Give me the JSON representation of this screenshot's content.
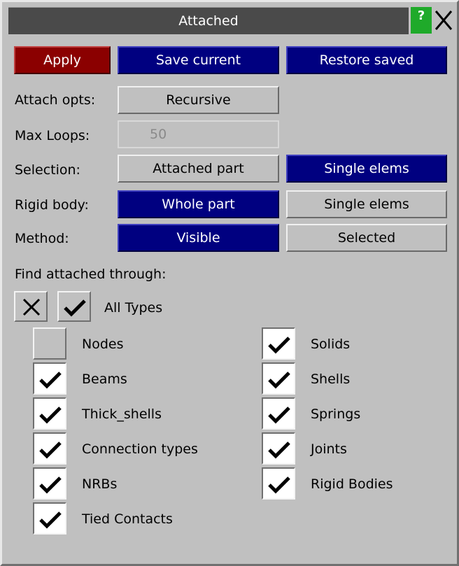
{
  "window": {
    "title": "Attached",
    "help_label": "?"
  },
  "actions": {
    "apply": "Apply",
    "save_current": "Save current",
    "restore_saved": "Restore saved"
  },
  "attach_opts": {
    "label": "Attach opts:",
    "value": "Recursive"
  },
  "max_loops": {
    "label": "Max Loops:",
    "value": "50"
  },
  "selection": {
    "label": "Selection:",
    "option_a": "Attached part",
    "option_b": "Single elems",
    "selected": "Single elems"
  },
  "rigid_body": {
    "label": "Rigid body:",
    "option_a": "Whole part",
    "option_b": "Single elems",
    "selected": "Whole part"
  },
  "method": {
    "label": "Method:",
    "option_a": "Visible",
    "option_b": "Selected",
    "selected": "Visible"
  },
  "find": {
    "heading": "Find attached through:",
    "all_types_label": "All Types",
    "items": [
      {
        "label": "Nodes",
        "checked": false
      },
      {
        "label": "Solids",
        "checked": true
      },
      {
        "label": "Beams",
        "checked": true
      },
      {
        "label": "Shells",
        "checked": true
      },
      {
        "label": "Thick_shells",
        "checked": true
      },
      {
        "label": "Springs",
        "checked": true
      },
      {
        "label": "Connection types",
        "checked": true
      },
      {
        "label": "Joints",
        "checked": true
      },
      {
        "label": "NRBs",
        "checked": true
      },
      {
        "label": "Rigid Bodies",
        "checked": true
      },
      {
        "label": "Tied Contacts",
        "checked": true
      }
    ]
  },
  "colors": {
    "selected": "#000080",
    "apply": "#8b0000",
    "help": "#1faa2a",
    "panel": "#c0c0c0"
  }
}
